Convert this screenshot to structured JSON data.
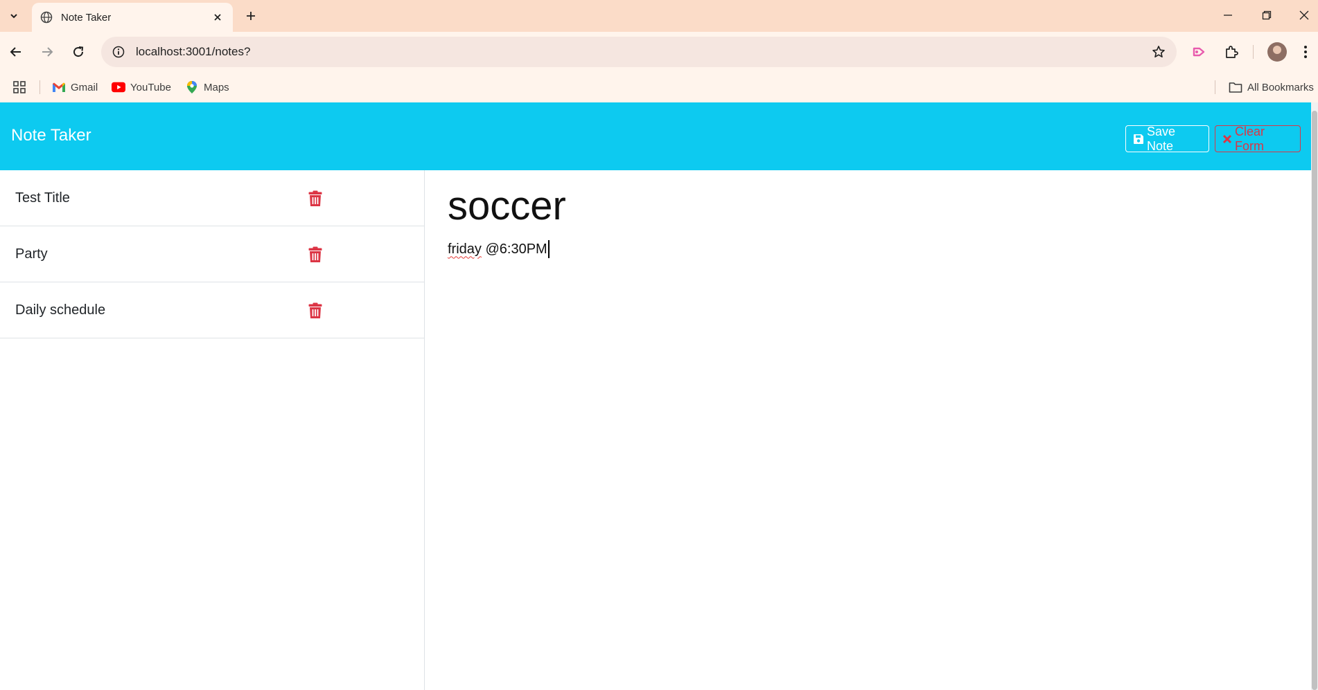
{
  "browser": {
    "tab_title": "Note Taker",
    "url": "localhost:3001/notes?",
    "bookmarks": [
      {
        "label": "Gmail",
        "icon": "gmail-icon"
      },
      {
        "label": "YouTube",
        "icon": "youtube-icon"
      },
      {
        "label": "Maps",
        "icon": "maps-icon"
      }
    ],
    "all_bookmarks_label": "All Bookmarks"
  },
  "app": {
    "brand": "Note Taker",
    "save_label": "Save Note",
    "clear_label": "Clear Form",
    "colors": {
      "navbar": "#0dcaf0",
      "danger": "#dc3545"
    }
  },
  "notes": [
    {
      "title": "Test Title"
    },
    {
      "title": "Party"
    },
    {
      "title": "Daily schedule"
    }
  ],
  "editor": {
    "title": "soccer",
    "text_word1": "friday",
    "text_rest": "@6:30PM"
  }
}
